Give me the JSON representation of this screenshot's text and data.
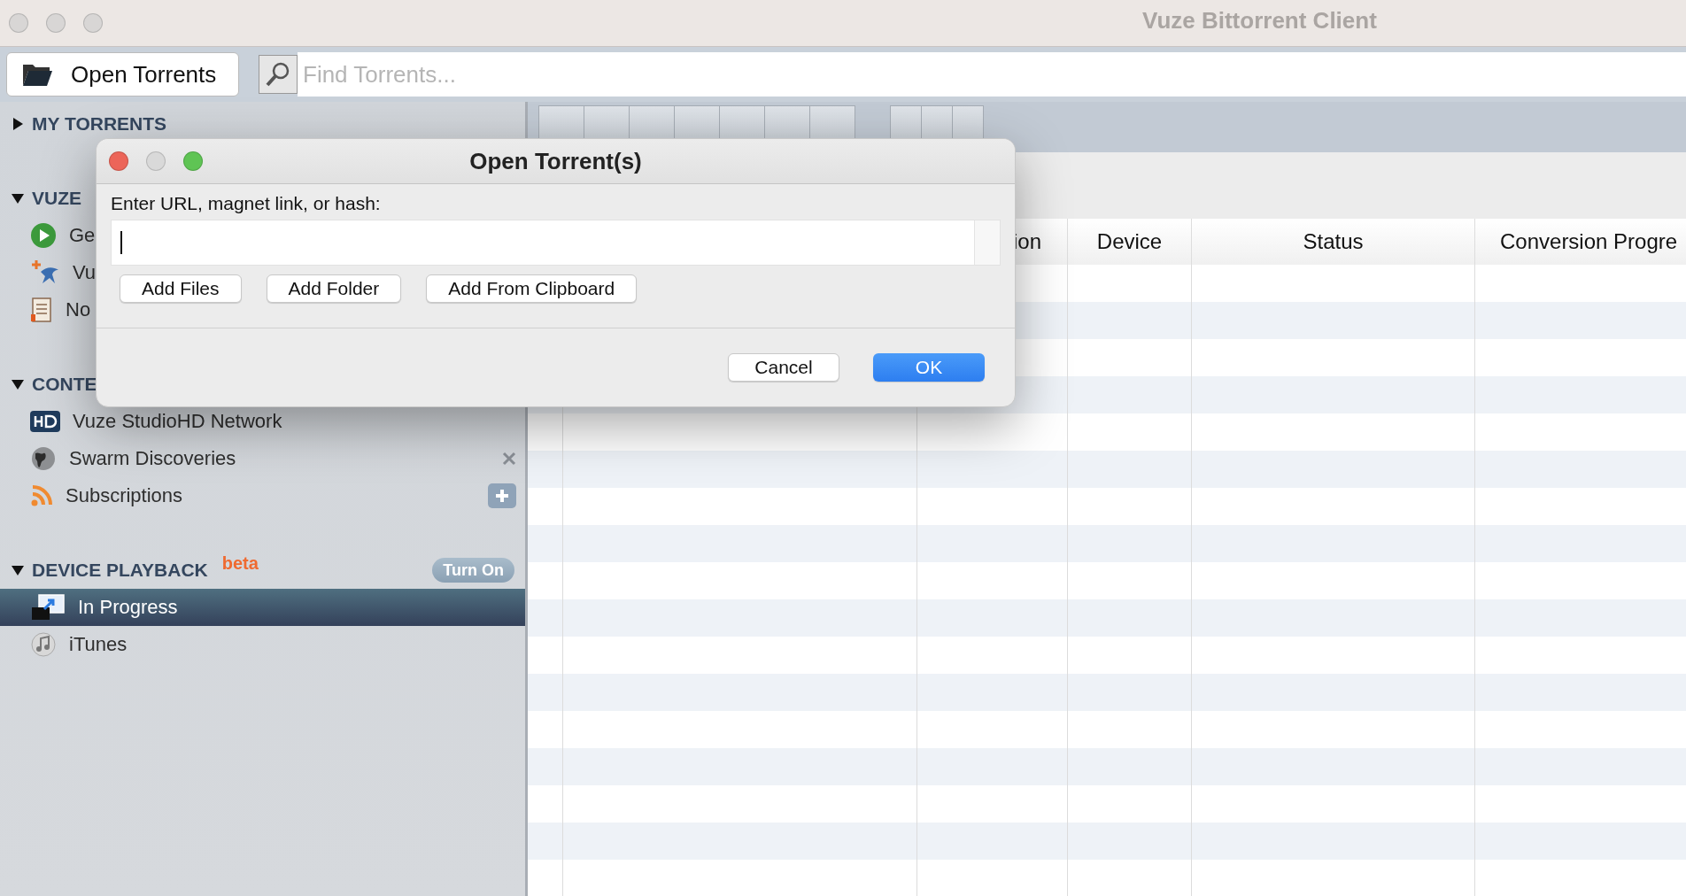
{
  "window": {
    "title": "Vuze Bittorrent Client"
  },
  "toolbar": {
    "open_button": "Open Torrents",
    "search": {
      "placeholder": "Find Torrents..."
    }
  },
  "sidebar": {
    "sections": [
      {
        "title": "MY TORRENTS",
        "expanded": false
      },
      {
        "title": "VUZE",
        "expanded": true,
        "items": [
          {
            "label": "Ge",
            "selected": false,
            "kind": "plain"
          },
          {
            "label": "Vu",
            "selected": false,
            "kind": "plain"
          },
          {
            "label": "No",
            "selected": false,
            "kind": "plain"
          }
        ]
      },
      {
        "title": "CONTE",
        "expanded": true,
        "items": [
          {
            "label": "Vuze StudioHD Network",
            "selected": false,
            "kind": "plain"
          },
          {
            "label": "Swarm Discoveries",
            "selected": false,
            "kind": "removable"
          },
          {
            "label": "Subscriptions",
            "selected": false,
            "kind": "addable"
          }
        ]
      },
      {
        "title": "DEVICE PLAYBACK",
        "expanded": true,
        "badge": "beta",
        "button": "Turn On",
        "items": [
          {
            "label": "In Progress",
            "selected": true,
            "kind": "plain"
          },
          {
            "label": "iTunes",
            "selected": false,
            "kind": "plain"
          }
        ]
      }
    ]
  },
  "table": {
    "columns": [
      "ion",
      "Device",
      "Status",
      "Conversion Progre"
    ]
  },
  "dialog": {
    "title": "Open Torrent(s)",
    "label": "Enter URL, magnet link, or hash:",
    "field": {
      "focused": true
    },
    "add_buttons": [
      "Add Files",
      "Add Folder",
      "Add From Clipboard"
    ],
    "buttons": [
      {
        "label": "Cancel",
        "default": false
      },
      {
        "label": "OK",
        "default": true
      }
    ]
  }
}
